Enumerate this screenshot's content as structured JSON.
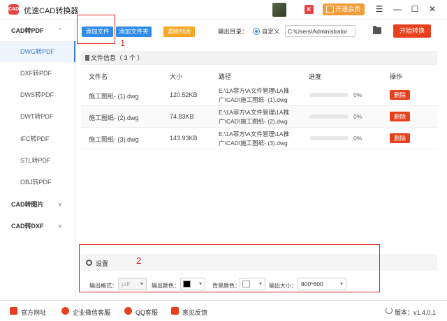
{
  "app": {
    "logo_text": "CAD",
    "title": "优速CAD转换器",
    "vip_label": "开通会员"
  },
  "window": {
    "menu_glyph": "☰",
    "min_glyph": "—",
    "max_glyph": "☐",
    "close_glyph": "✕"
  },
  "sidebar": {
    "groups": [
      {
        "label": "CAD转PDF",
        "chevron": "^"
      },
      {
        "label": "CAD转图片",
        "chevron": "v"
      },
      {
        "label": "CAD转DXF",
        "chevron": "v"
      }
    ],
    "items": [
      {
        "label": "DWG转PDF",
        "active": true
      },
      {
        "label": "DXF转PDF"
      },
      {
        "label": "DWS转PDF"
      },
      {
        "label": "DWT转PDF"
      },
      {
        "label": "IFC转PDF"
      },
      {
        "label": "STL转PDF"
      },
      {
        "label": "OBJ转PDF"
      }
    ]
  },
  "toolbar": {
    "add_file": "添加文件",
    "add_folder": "添加文件夹",
    "clear_list": "清除列表",
    "output_dir_label": "输出目录：",
    "custom_label": "自定义",
    "output_path": "C:\\Users\\Administrator",
    "start_label": "开始转换"
  },
  "annotations": {
    "one": "1",
    "two": "2"
  },
  "file_panel": {
    "header": "文件信息（ 3 个 ）",
    "columns": {
      "name": "文件名",
      "size": "大小",
      "path": "路径",
      "progress": "进度",
      "action": "操作"
    },
    "rows": [
      {
        "name": "施工图纸- (1).dwg",
        "size": "120.52KB",
        "path1": "E:\\1A菲方\\A文件管理\\1A推",
        "path2": "广\\CAD\\施工图纸- (1).dwg",
        "progress": 0,
        "pct": "0%",
        "delete": "删除"
      },
      {
        "name": "施工图纸- (2).dwg",
        "size": "74.83KB",
        "path1": "E:\\1A菲方\\A文件管理\\1A推",
        "path2": "广\\CAD\\施工图纸- (2).dwg",
        "progress": 0,
        "pct": "0%",
        "delete": "删除"
      },
      {
        "name": "施工图纸- (3).dwg",
        "size": "143.93KB",
        "path1": "E:\\1A菲方\\A文件管理\\1A推",
        "path2": "广\\CAD\\施工图纸- (3).dwg",
        "progress": 0,
        "pct": "0%",
        "delete": "删除"
      }
    ]
  },
  "settings": {
    "title": "设置",
    "format_label": "输出格式：",
    "format_value": "pdf",
    "color_label": "输出颜色：",
    "color_value": "#000000",
    "bg_label": "背景颜色：",
    "bg_value": "#ffffff",
    "size_label": "输出大小：",
    "size_value": "800*600"
  },
  "footer": {
    "website": "官方网址",
    "wechat": "企业微信客服",
    "qq": "QQ客服",
    "feedback": "意见反馈",
    "version": "版本：v1.4.0.1"
  }
}
